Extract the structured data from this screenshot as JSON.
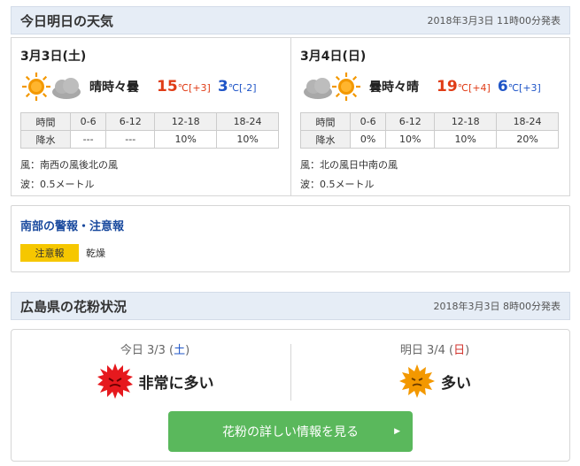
{
  "forecast": {
    "title": "今日明日の天気",
    "issued": "2018年3月3日 11時00分発表",
    "days": [
      {
        "date": "3月3日(土)",
        "icons": [
          "sun-icon",
          "cloud-icon"
        ],
        "weather": "晴時々曇",
        "high": "15",
        "high_unit": "℃",
        "high_diff": "[+3]",
        "low": "3",
        "low_unit": "℃",
        "low_diff": "[-2]",
        "rain_header": [
          "時間",
          "0-6",
          "6-12",
          "12-18",
          "18-24"
        ],
        "rain_row": [
          "降水",
          "---",
          "---",
          "10%",
          "10%"
        ],
        "wind": "風：南西の風後北の風",
        "wave": "波：0.5メートル"
      },
      {
        "date": "3月4日(日)",
        "icons": [
          "cloud-icon",
          "sun-icon"
        ],
        "weather": "曇時々晴",
        "high": "19",
        "high_unit": "℃",
        "high_diff": "[+4]",
        "low": "6",
        "low_unit": "℃",
        "low_diff": "[+3]",
        "rain_header": [
          "時間",
          "0-6",
          "6-12",
          "12-18",
          "18-24"
        ],
        "rain_row": [
          "降水",
          "0%",
          "10%",
          "10%",
          "20%"
        ],
        "wind": "風：北の風日中南の風",
        "wave": "波：0.5メートル"
      }
    ]
  },
  "warnings": {
    "title": "南部の警報・注意報",
    "badge": "注意報",
    "item": "乾燥",
    "badge_color": "#f6c700"
  },
  "pollen": {
    "title": "広島県の花粉状況",
    "issued": "2018年3月3日 8時00分発表",
    "today": {
      "prefix": "今日 3/3 (",
      "dow": "土",
      "suffix": ")",
      "level": "非常に多い",
      "icon": "pollen-very-high-icon",
      "color": "#e6191e"
    },
    "tomorrow": {
      "prefix": "明日 3/4 (",
      "dow": "日",
      "suffix": ")",
      "level": "多い",
      "icon": "pollen-high-icon",
      "color": "#f39800"
    },
    "button": "花粉の詳しい情報を見る",
    "button_arrow": "▶"
  },
  "colors": {
    "accent_green": "#5ab85c",
    "high_temp": "#e03c16",
    "low_temp": "#1f55c7",
    "header_bg": "#e6edf6"
  }
}
